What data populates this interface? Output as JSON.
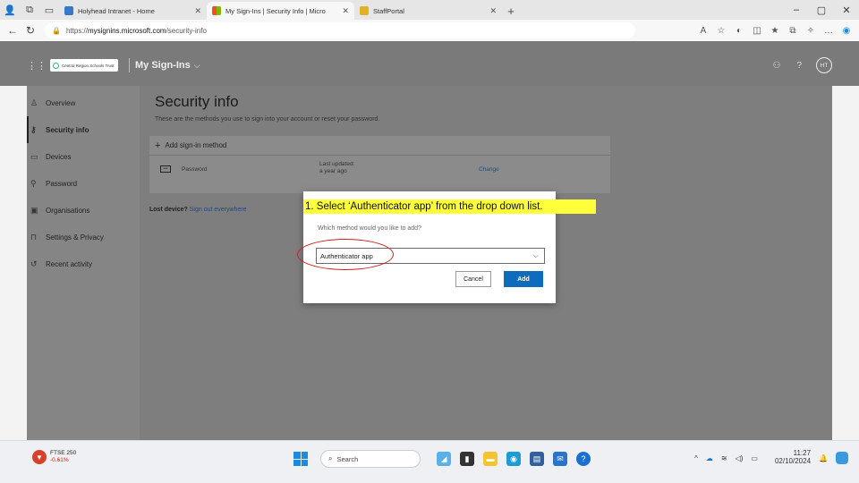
{
  "browser": {
    "tabs": [
      {
        "label": "Holyhead Intranet - Home",
        "color": "#3a78c8"
      },
      {
        "label": "My Sign-Ins | Security Info | Micro",
        "color": "#2ba24c"
      },
      {
        "label": "StaffPortal",
        "color": "#e2b12a"
      }
    ],
    "new_tab": "+",
    "url_prefix": "https://",
    "url_host": "mysignins.microsoft.com",
    "url_path": "/security-info",
    "window_controls": {
      "minimize": "–",
      "maximize": "▢",
      "close": "✕"
    }
  },
  "app_header": {
    "org_logo_text": "Central Region Schools Trust",
    "title": "My Sign-Ins",
    "avatar_initials": "HT"
  },
  "sidebar": {
    "items": [
      {
        "label": "Overview",
        "icon": "person-icon"
      },
      {
        "label": "Security info",
        "icon": "key-icon"
      },
      {
        "label": "Devices",
        "icon": "laptop-icon"
      },
      {
        "label": "Password",
        "icon": "key2-icon"
      },
      {
        "label": "Organisations",
        "icon": "briefcase-icon"
      },
      {
        "label": "Settings & Privacy",
        "icon": "lock-icon"
      },
      {
        "label": "Recent activity",
        "icon": "history-icon"
      }
    ],
    "active_index": 1
  },
  "main": {
    "title": "Security info",
    "subtitle": "These are the methods you use to sign into your account or reset your password.",
    "add_method_label": "Add sign-in method",
    "method": {
      "name": "Password",
      "last_updated_label": "Last updated:",
      "last_updated_value": "a year ago",
      "change_label": "Change"
    },
    "lost_device_label": "Lost device?",
    "lost_device_link": "Sign out everywhere"
  },
  "dialog": {
    "question": "Which method would you like to add?",
    "selected_option": "Authenticator app",
    "cancel_label": "Cancel",
    "add_label": "Add"
  },
  "annotation": {
    "callout_text": "1.  Select ‘Authenticator app’ from the drop down list.",
    "highlight_color": "#ffff3a",
    "ring_color": "#cc2222"
  },
  "taskbar": {
    "stock_name": "FTSE 250",
    "stock_change": "-0.61%",
    "search_label": "Search",
    "time": "11:27",
    "date": "02/10/2024"
  },
  "colors": {
    "accent": "#0f6cbd",
    "overlay_grey": "#7e7e7e"
  }
}
